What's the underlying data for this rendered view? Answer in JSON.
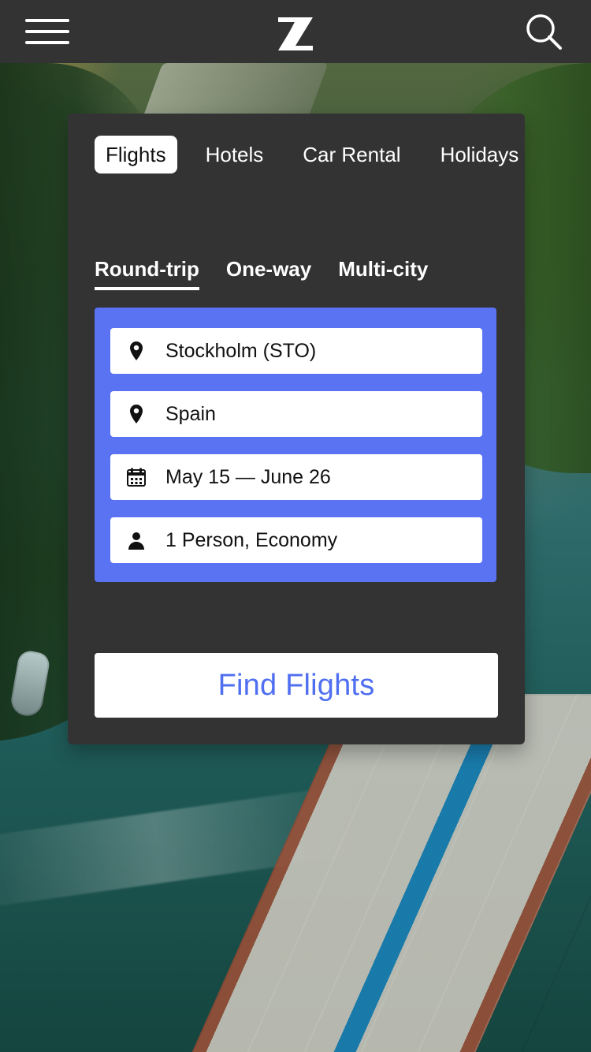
{
  "header": {
    "menu_icon": "hamburger-menu-icon",
    "logo_icon": "z-logo-icon",
    "search_icon": "search-icon"
  },
  "categories": {
    "tabs": [
      {
        "label": "Flights",
        "active": true
      },
      {
        "label": "Hotels",
        "active": false
      },
      {
        "label": "Car Rental",
        "active": false
      },
      {
        "label": "Holidays",
        "active": false
      }
    ]
  },
  "trip_types": {
    "tabs": [
      {
        "label": "Round-trip",
        "active": true
      },
      {
        "label": "One-way",
        "active": false
      },
      {
        "label": "Multi-city",
        "active": false
      }
    ]
  },
  "search_form": {
    "panel_color": "#5a73f3",
    "fields": [
      {
        "icon": "location-pin-icon",
        "value": "Stockholm (STO)"
      },
      {
        "icon": "location-pin-icon",
        "value": "Spain"
      },
      {
        "icon": "calendar-icon",
        "value": "May 15 — June 26"
      },
      {
        "icon": "person-icon",
        "value": "1 Person, Economy"
      }
    ]
  },
  "cta": {
    "label": "Find Flights",
    "text_color": "#4f6ff0"
  },
  "colors": {
    "topbar_bg": "#333333",
    "card_bg": "#333333",
    "active_tab_bg": "#ffffff"
  }
}
